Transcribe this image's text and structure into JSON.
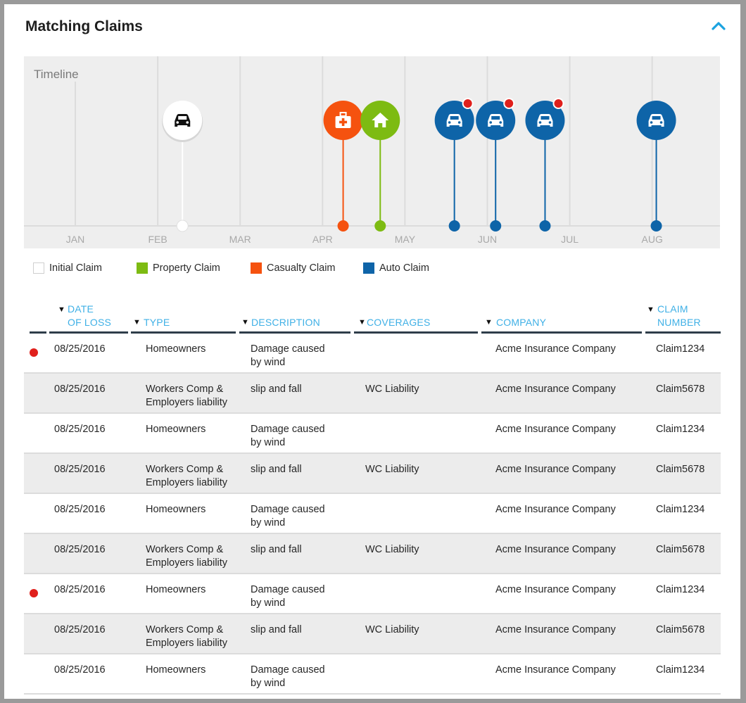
{
  "header": {
    "title": "Matching Claims",
    "collapse_icon": "chevron-up-icon",
    "accent_color": "#1ba3e0"
  },
  "timeline": {
    "label": "Timeline",
    "months": [
      "JAN",
      "FEB",
      "MAR",
      "APR",
      "MAY",
      "JUN",
      "JUL",
      "AUG"
    ],
    "events": [
      {
        "type": "initial",
        "icon": "car-icon",
        "month_position": 2.3,
        "alert": false
      },
      {
        "type": "casualty",
        "icon": "medical-kit-icon",
        "month_position": 4.25,
        "alert": false
      },
      {
        "type": "property",
        "icon": "home-icon",
        "month_position": 4.7,
        "alert": false
      },
      {
        "type": "auto",
        "icon": "car-icon",
        "month_position": 5.6,
        "alert": true
      },
      {
        "type": "auto",
        "icon": "car-icon",
        "month_position": 6.1,
        "alert": true
      },
      {
        "type": "auto",
        "icon": "car-icon",
        "month_position": 6.7,
        "alert": true
      },
      {
        "type": "auto",
        "icon": "car-icon",
        "month_position": 8.05,
        "alert": false
      }
    ]
  },
  "legend": [
    {
      "key": "initial",
      "label": "Initial Claim",
      "color": "#ffffff"
    },
    {
      "key": "property",
      "label": "Property Claim",
      "color": "#7dbb12"
    },
    {
      "key": "casualty",
      "label": "Casualty Claim",
      "color": "#f5520f"
    },
    {
      "key": "auto",
      "label": "Auto Claim",
      "color": "#0e64a8"
    }
  ],
  "colors": {
    "initial": "#ffffff",
    "property": "#7dbb12",
    "casualty": "#f5520f",
    "auto": "#0e64a8",
    "alert": "#e0201c"
  },
  "table": {
    "columns": [
      {
        "key": "date",
        "label_line1": "DATE",
        "label_line2": "OF LOSS"
      },
      {
        "key": "type",
        "label_line1": "",
        "label_line2": "TYPE"
      },
      {
        "key": "description",
        "label_line1": "",
        "label_line2": "DESCRIPTION"
      },
      {
        "key": "coverages",
        "label_line1": "",
        "label_line2": "COVERAGES"
      },
      {
        "key": "company",
        "label_line1": "",
        "label_line2": "COMPANY"
      },
      {
        "key": "claim_number",
        "label_line1": "CLAIM",
        "label_line2": "NUMBER"
      }
    ],
    "rows": [
      {
        "flag": true,
        "date": "08/25/2016",
        "type_l1": "Homeowners",
        "type_l2": "",
        "desc_l1": "Damage caused",
        "desc_l2": "by wind",
        "coverages": "",
        "company": "Acme Insurance Company",
        "claim_number": "Claim1234"
      },
      {
        "flag": false,
        "date": "08/25/2016",
        "type_l1": "Workers Comp &",
        "type_l2": "Employers liability",
        "desc_l1": "slip and fall",
        "desc_l2": "",
        "coverages": "WC Liability",
        "company": "Acme Insurance Company",
        "claim_number": "Claim5678"
      },
      {
        "flag": false,
        "date": "08/25/2016",
        "type_l1": "Homeowners",
        "type_l2": "",
        "desc_l1": "Damage caused",
        "desc_l2": "by wind",
        "coverages": "",
        "company": "Acme Insurance Company",
        "claim_number": "Claim1234"
      },
      {
        "flag": false,
        "date": "08/25/2016",
        "type_l1": "Workers Comp &",
        "type_l2": "Employers liability",
        "desc_l1": "slip and fall",
        "desc_l2": "",
        "coverages": "WC Liability",
        "company": "Acme Insurance Company",
        "claim_number": "Claim5678"
      },
      {
        "flag": false,
        "date": "08/25/2016",
        "type_l1": "Homeowners",
        "type_l2": "",
        "desc_l1": "Damage caused",
        "desc_l2": "by wind",
        "coverages": "",
        "company": "Acme Insurance Company",
        "claim_number": "Claim1234"
      },
      {
        "flag": false,
        "date": "08/25/2016",
        "type_l1": "Workers Comp &",
        "type_l2": "Employers liability",
        "desc_l1": "slip and fall",
        "desc_l2": "",
        "coverages": "WC Liability",
        "company": "Acme Insurance Company",
        "claim_number": "Claim5678"
      },
      {
        "flag": true,
        "date": "08/25/2016",
        "type_l1": "Homeowners",
        "type_l2": "",
        "desc_l1": "Damage caused",
        "desc_l2": "by wind",
        "coverages": "",
        "company": "Acme Insurance Company",
        "claim_number": "Claim1234"
      },
      {
        "flag": false,
        "date": "08/25/2016",
        "type_l1": "Workers Comp &",
        "type_l2": "Employers liability",
        "desc_l1": "slip and fall",
        "desc_l2": "",
        "coverages": "WC Liability",
        "company": "Acme Insurance Company",
        "claim_number": "Claim5678"
      },
      {
        "flag": false,
        "date": "08/25/2016",
        "type_l1": "Homeowners",
        "type_l2": "",
        "desc_l1": "Damage caused",
        "desc_l2": "by wind",
        "coverages": "",
        "company": "Acme Insurance Company",
        "claim_number": "Claim1234"
      }
    ]
  }
}
